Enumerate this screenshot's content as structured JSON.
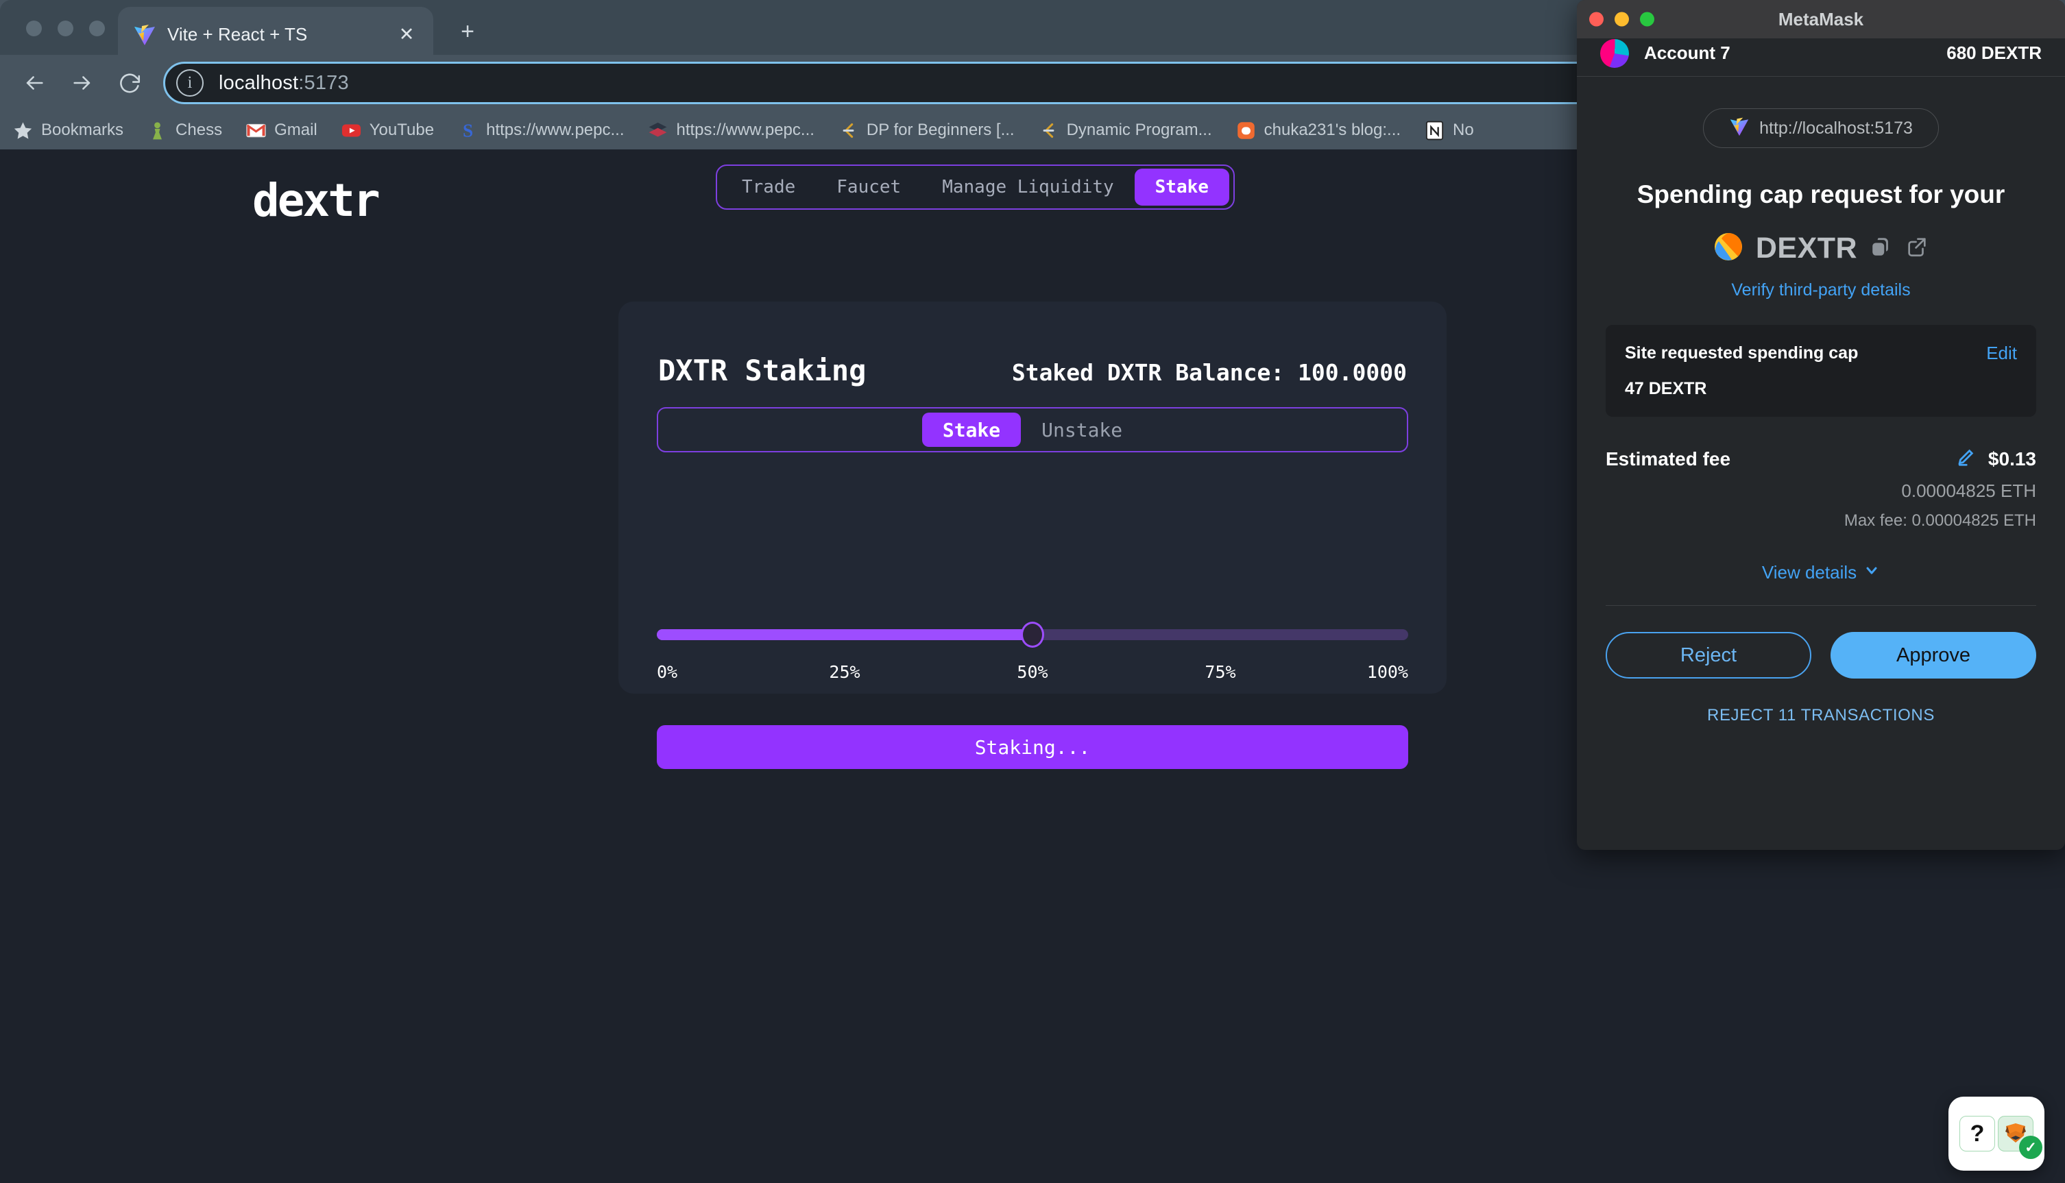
{
  "browser": {
    "tab": {
      "title": "Vite + React + TS",
      "favicon": "vite-icon",
      "close_label": "✕"
    },
    "newtab_label": "+",
    "nav": {
      "back": "←",
      "forward": "→",
      "reload": "⟳"
    },
    "omnibox": {
      "url_host": "localhost",
      "url_port": ":5173",
      "site_info_icon": "info-icon",
      "zoom_out_icon": "zoom-out-icon",
      "bookmark_icon": "star-icon"
    },
    "bookmarks": [
      {
        "label": "Bookmarks",
        "icon": "star-icon"
      },
      {
        "label": "Chess",
        "icon": "chess-pawn-icon"
      },
      {
        "label": "Gmail",
        "icon": "gmail-icon"
      },
      {
        "label": "YouTube",
        "icon": "youtube-icon"
      },
      {
        "label": "https://www.pepc...",
        "icon": "stack-overflow-icon"
      },
      {
        "label": "https://www.pepc...",
        "icon": "book-icon"
      },
      {
        "label": "DP for Beginners [...",
        "icon": "leetcode-icon"
      },
      {
        "label": "Dynamic Program...",
        "icon": "leetcode-icon"
      },
      {
        "label": "chuka231's blog:...",
        "icon": "blogger-icon"
      },
      {
        "label": "No",
        "icon": "notion-icon"
      }
    ]
  },
  "app": {
    "logo": "dextr",
    "nav": [
      {
        "label": "Trade",
        "active": false
      },
      {
        "label": "Faucet",
        "active": false
      },
      {
        "label": "Manage Liquidity",
        "active": false
      },
      {
        "label": "Stake",
        "active": true
      }
    ],
    "card": {
      "title": "DXTR Staking",
      "balance_label": "Staked DXTR Balance: 100.0000",
      "tabs": [
        {
          "label": "Stake",
          "active": true
        },
        {
          "label": "Unstake",
          "active": false
        }
      ],
      "slider": {
        "value_percent": 50,
        "ticks": [
          "0%",
          "25%",
          "50%",
          "75%",
          "100%"
        ],
        "fill_color": "#9d4dff",
        "track_color": "#443768"
      },
      "action_button": "Staking..."
    },
    "accent_color": "#9333ff"
  },
  "metamask": {
    "window_title": "MetaMask",
    "account": {
      "name": "Account 7",
      "balance": "680 DEXTR"
    },
    "site": {
      "url": "http://localhost:5173",
      "icon": "vite-icon"
    },
    "heading": "Spending cap request for your",
    "token": {
      "symbol": "DEXTR",
      "icon": "dextr-token-icon",
      "copy_icon": "copy-icon",
      "external_icon": "external-link-icon"
    },
    "verify_link": "Verify third-party details",
    "cap": {
      "label": "Site requested spending cap",
      "edit_label": "Edit",
      "value": "47 DEXTR"
    },
    "fee": {
      "label": "Estimated fee",
      "edit_icon": "pencil-icon",
      "usd": "$0.13",
      "eth": "0.00004825 ETH",
      "max": "Max fee: 0.00004825 ETH"
    },
    "view_details": "View details",
    "view_details_icon": "chevron-down-icon",
    "buttons": {
      "reject": "Reject",
      "approve": "Approve"
    },
    "reject_all": "REJECT 11 TRANSACTIONS",
    "accent_color": "#43a3f5"
  },
  "widget": {
    "question_label": "?",
    "fox_icon": "metamask-fox-icon",
    "check_icon": "check-icon",
    "check_label": "✓"
  }
}
